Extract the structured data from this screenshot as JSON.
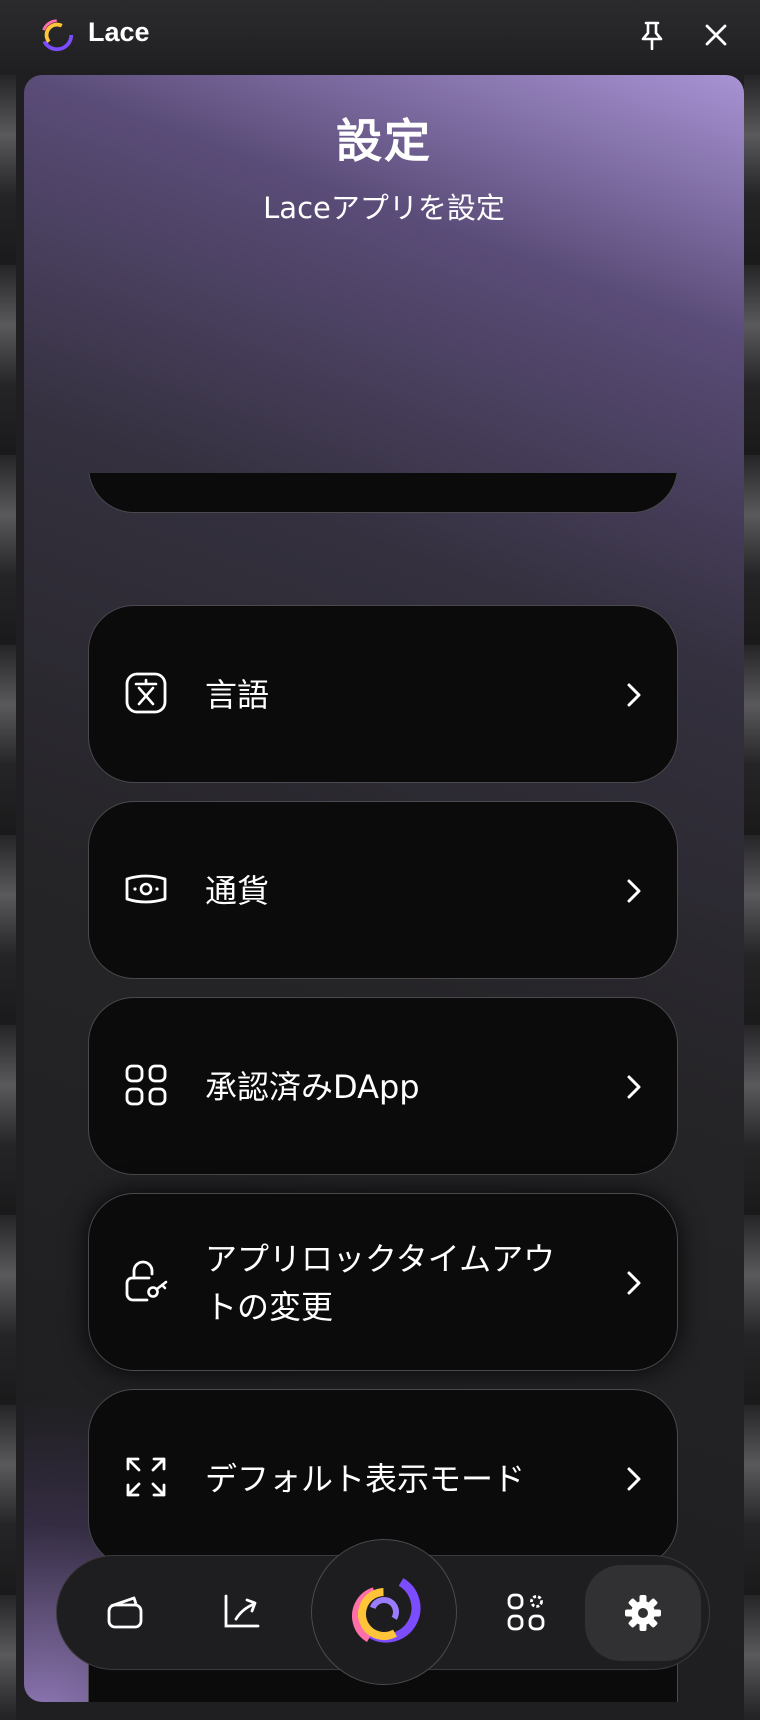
{
  "app": {
    "name": "Lace"
  },
  "titlebar": {
    "pin_icon": "pin-icon",
    "close_icon": "close-icon"
  },
  "header": {
    "title": "設定",
    "subtitle": "Laceアプリを設定"
  },
  "settings": {
    "items": [
      {
        "label": "",
        "icon": "none"
      },
      {
        "label": "言語",
        "icon": "translate-icon"
      },
      {
        "label": "通貨",
        "icon": "banknote-icon"
      },
      {
        "label": "承認済みDApp",
        "icon": "grid-icon"
      },
      {
        "label": "アプリロックタイムアウトの変更",
        "icon": "lock-key-icon"
      },
      {
        "label": "デフォルト表示モード",
        "icon": "expand-icon"
      },
      {
        "label": "",
        "icon": "none"
      }
    ]
  },
  "bottom_nav": {
    "items": [
      "wallet-icon",
      "activity-icon",
      "lace-logo-icon",
      "apps-icon",
      "settings-gear-icon"
    ],
    "active": "settings"
  },
  "colors": {
    "accent_purple": "#7b4dff",
    "accent_pink": "#ff6fa8",
    "accent_yellow": "#ffc43a",
    "card_bg": "#0b0b0c"
  }
}
